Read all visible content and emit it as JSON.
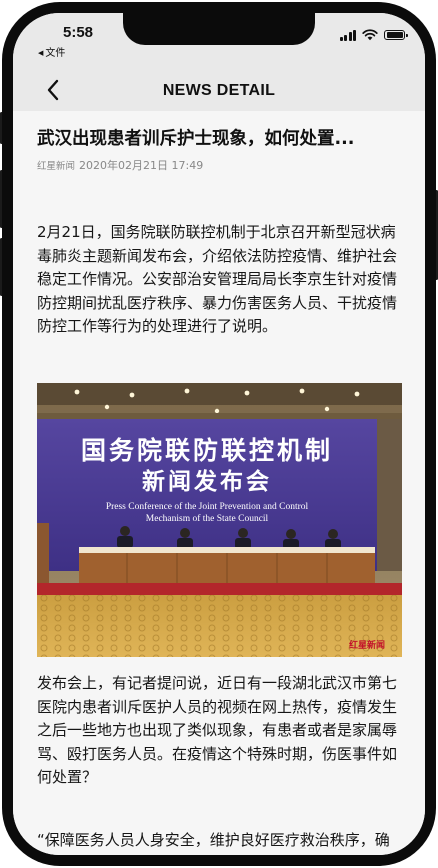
{
  "status_bar": {
    "time": "5:58",
    "back_app": "文件",
    "icons": [
      "cellular-signal-icon",
      "wifi-icon",
      "battery-icon"
    ]
  },
  "nav": {
    "title": "NEWS DETAIL",
    "back_icon": "chevron-left-icon"
  },
  "article": {
    "title": "武汉出现患者训斥护士现象，如何处置...",
    "source": "红星新闻",
    "date": "2020年02月21日 17:49",
    "paragraphs": [
      "2月21日，国务院联防联控机制于北京召开新型冠状病毒肺炎主题新闻发布会，介绍依法防控疫情、维护社会稳定工作情况。公安部治安管理局局长李京生针对疫情防控期间扰乱医疗秩序、暴力伤害医务人员、干扰疫情防控工作等行为的处理进行了说明。",
      "发布会上，有记者提问说，近日有一段湖北武汉市第七医院内患者训斥医护人员的视频在网上热传，疫情发生之后一些地方也出现了类似现象，有患者或者是家属辱骂、殴打医务人员。在疫情这个特殊时期，伤医事件如何处置？",
      "“保障医务人员人身安全，维护良好医疗救治秩序，确保疫情防控工作顺利开展，是当前公安机关一项"
    ],
    "image": {
      "banner_cn_line1": "国务院联防联控机制",
      "banner_cn_line2": "新闻发布会",
      "banner_en_line1": "Press Conference of the Joint Prevention and Control",
      "banner_en_line2": "Mechanism of the State Council",
      "watermark": "红星新闻"
    }
  },
  "colors": {
    "bar_background": "#e9e9e9",
    "content_background": "#f6f6f6",
    "banner_purple": "#4a3a8f"
  }
}
